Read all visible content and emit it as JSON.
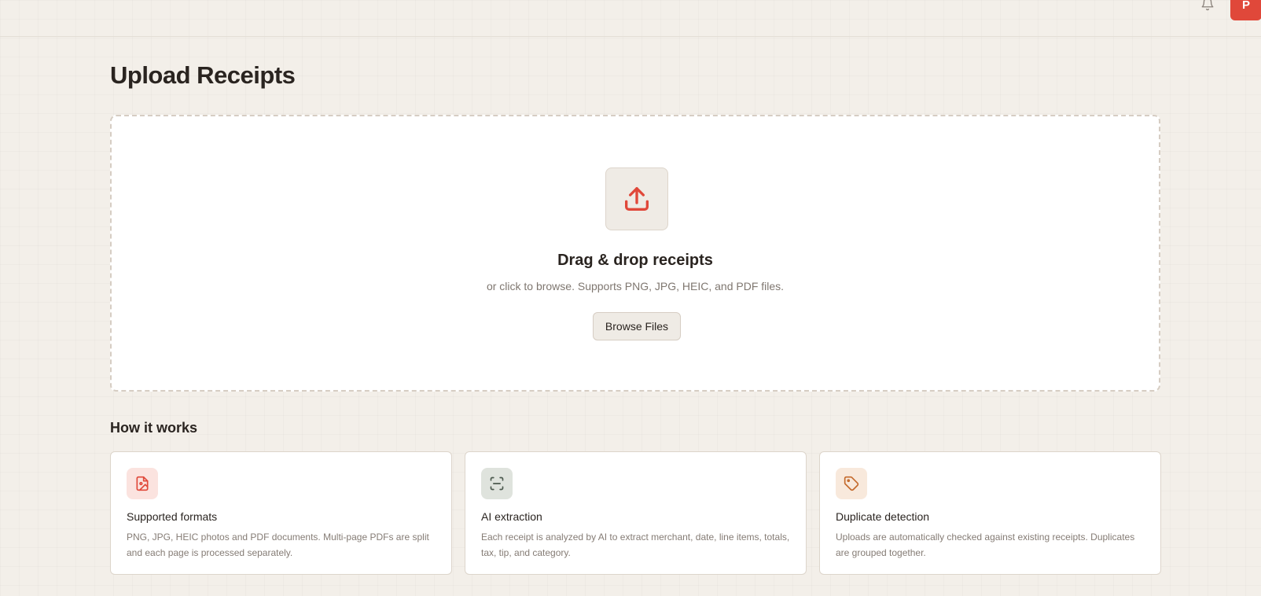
{
  "header": {
    "avatar_initial": "P",
    "bell_icon": "bell-icon"
  },
  "page": {
    "title": "Upload Receipts"
  },
  "dropzone": {
    "icon": "upload-icon",
    "title": "Drag & drop receipts",
    "subtitle": "or click to browse. Supports PNG, JPG, HEIC, and PDF files.",
    "browse_label": "Browse Files"
  },
  "how_it_works": {
    "title": "How it works",
    "cards": [
      {
        "icon": "image-file-icon",
        "icon_color": "#e0483a",
        "icon_bg": "#fbe3df",
        "title": "Supported formats",
        "text": "PNG, JPG, HEIC photos and PDF documents. Multi-page PDFs are split and each page is processed separately."
      },
      {
        "icon": "scan-icon",
        "icon_color": "#4d5a4f",
        "icon_bg": "#dfe3dd",
        "title": "AI extraction",
        "text": "Each receipt is analyzed by AI to extract merchant, date, line items, totals, tax, tip, and category."
      },
      {
        "icon": "tag-icon",
        "icon_color": "#c46a2c",
        "icon_bg": "#f8e9dc",
        "title": "Duplicate detection",
        "text": "Uploads are automatically checked against existing receipts. Duplicates are grouped together."
      }
    ]
  },
  "colors": {
    "accent": "#e0483a",
    "background": "#f3efe9"
  }
}
